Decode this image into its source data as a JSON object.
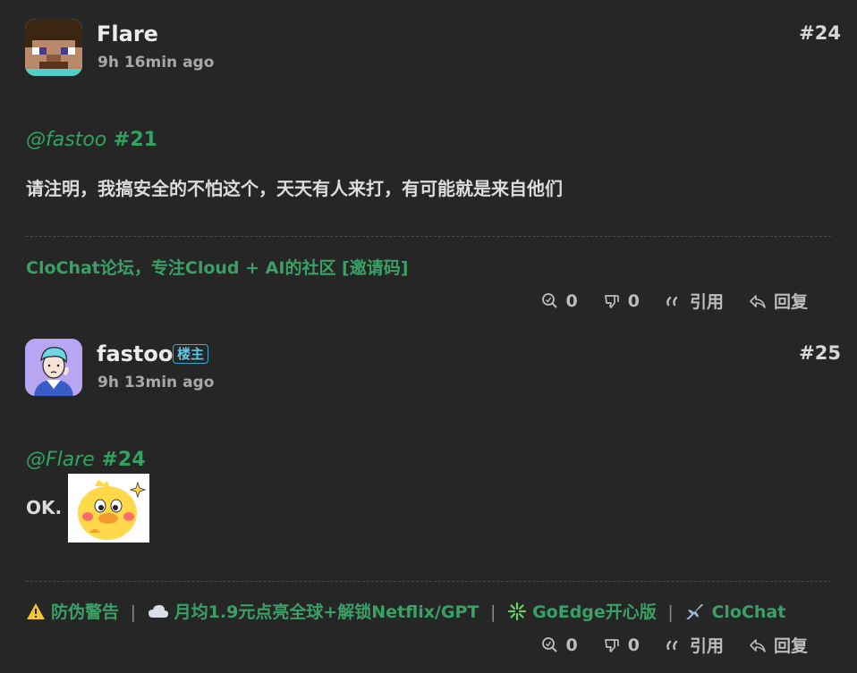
{
  "posts": [
    {
      "author": "Flare",
      "time": "9h 16min ago",
      "floor": "#24",
      "mention_user": "@fastoo",
      "mention_floor": "#21",
      "content": "请注明，我搞安全的不怕这个，天天有人来打，有可能就是来自他们",
      "signature": "CloChat论坛，专注Cloud + AI的社区 [邀请码]",
      "likes": "0",
      "dislikes": "0",
      "quote_label": "引用",
      "reply_label": "回复"
    },
    {
      "author": "fastoo",
      "badge": "楼主",
      "time": "9h 13min ago",
      "floor": "#25",
      "mention_user": "@Flare",
      "mention_floor": "#24",
      "content": "OK.",
      "signature_items": [
        {
          "icon": "warning-icon",
          "text": "防伪警告"
        },
        {
          "icon": "cloud-icon",
          "text": "月均1.9元点亮全球+解锁Netflix/GPT"
        },
        {
          "icon": "sparkle-icon",
          "text": "GoEdge开心版"
        },
        {
          "icon": "plane-icon",
          "text": "CloChat"
        }
      ],
      "signature_separator": "|",
      "likes": "0",
      "dislikes": "0",
      "quote_label": "引用",
      "reply_label": "回复"
    }
  ],
  "colors": {
    "background": "#262626",
    "link_green": "#2fa35f",
    "signature_green": "#3aa066",
    "badge_blue": "#3aa9cc"
  }
}
